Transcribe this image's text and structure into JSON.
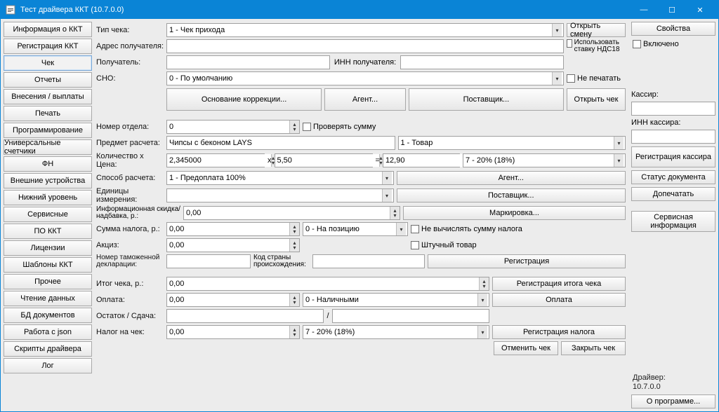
{
  "title": "Тест драйвера ККТ (10.7.0.0)",
  "nav": [
    "Информация о ККТ",
    "Регистрация ККТ",
    "Чек",
    "Отчеты",
    "Внесения / выплаты",
    "Печать",
    "Программирование",
    "Универсальные счетчики",
    "ФН",
    "Внешние устройства",
    "Нижний уровень",
    "Сервисные",
    "ПО ККТ",
    "Лицензии",
    "Шаблоны ККТ",
    "Прочее",
    "Чтение данных",
    "БД документов",
    "Работа с json",
    "Скрипты драйвера",
    "Лог"
  ],
  "nav_active": 2,
  "labels": {
    "tip_cheka": "Тип чека:",
    "adres": "Адрес получателя:",
    "poluchatel": "Получатель:",
    "inn_poluch": "ИНН получателя:",
    "sno": "СНО:",
    "open_shift": "Открыть смену",
    "use_vat18": "Использовать ставку НДС18",
    "ne_pechatat": "Не печатать",
    "osnovanie": "Основание коррекции...",
    "agent": "Агент...",
    "postavshik": "Поставщик...",
    "open_check": "Открыть чек",
    "nomer_otdela": "Номер отдела:",
    "proveryat": "Проверять сумму",
    "predmet": "Предмет расчета:",
    "kolxcena": "Количество x Цена:",
    "sposob": "Способ расчета:",
    "agent2": "Агент...",
    "edin": "Единицы измерения:",
    "postavshik2": "Поставщик...",
    "info_sk": "Информационная скидка/надбавка, р.:",
    "markirovka": "Маркировка...",
    "summa_naloga": "Сумма налога, р.:",
    "nevychis": "Не вычислять сумму налога",
    "akciz": "Акциз:",
    "shtuch": "Штучный товар",
    "nomer_tam": "Номер таможенной декларации:",
    "kod_strany": "Код страны происхождения:",
    "registraciya": "Регистрация",
    "itog": "Итог чека, р.:",
    "reg_itoga": "Регистрация итога чека",
    "oplata": "Оплата:",
    "oplata_btn": "Оплата",
    "ostatok": "Остаток / Сдача:",
    "nalog_chek": "Налог на чек:",
    "reg_naloga": "Регистрация налога",
    "otmenit": "Отменить чек",
    "zakryt": "Закрыть чек",
    "svoistva": "Свойства",
    "vklucheno": "Включено",
    "kassir": "Кассир:",
    "inn_kassira": "ИНН кассира:",
    "reg_kassira": "Регистрация кассира",
    "status_doc": "Статус документа",
    "dopechatat": "Допечатать",
    "servis_info": "Сервисная информация",
    "driver": "Драйвер:",
    "version": "10.7.0.0",
    "about": "О программе..."
  },
  "values": {
    "tip_cheka": "1 - Чек прихода",
    "sno": "0 - По умолчанию",
    "nomer_otdela": "0",
    "predmet_text": "Чипсы с беконом LAYS",
    "predmet_combo": "1 - Товар",
    "kol": "2,345000",
    "cena": "5,50",
    "summa": "12,90",
    "nalog_rate": "7 - 20% (18%)",
    "sposob": "1 - Предоплата 100%",
    "info_sk": "0,00",
    "summa_naloga": "0,00",
    "nalog_pos": "0 - На позицию",
    "akciz": "0,00",
    "itog": "0,00",
    "oplata_val": "0,00",
    "oplata_type": "0 - Наличными",
    "nalog_chek": "0,00",
    "nalog_chek_rate": "7 - 20% (18%)",
    "x": "x",
    "eq": "=",
    "slash": "/"
  }
}
